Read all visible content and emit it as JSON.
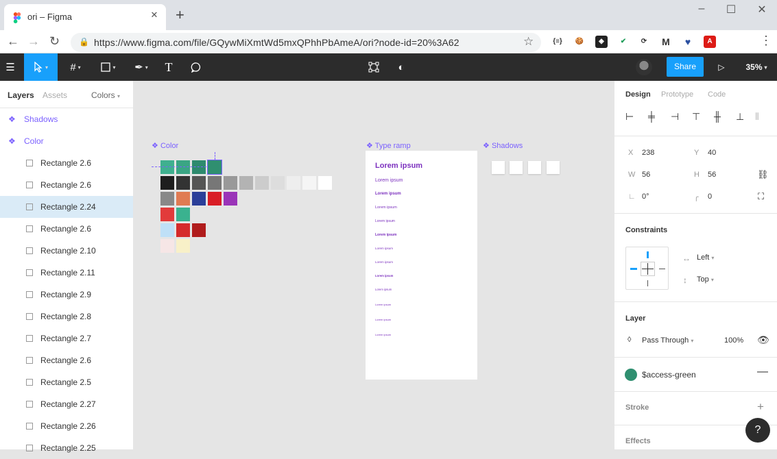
{
  "browser": {
    "tab_title": "ori – Figma",
    "tab_close": "✕",
    "new_tab": "+",
    "url": "https://www.figma.com/file/GQywMiXmtWd5mxQPhhPbAmeA/ori?node-id=20%3A62",
    "extensions": [
      "{≡}",
      "🍪",
      "◈",
      "✔",
      "⟳",
      "M",
      "♥",
      "A"
    ]
  },
  "toolbar": {
    "share_label": "Share",
    "zoom": "35%",
    "tools": [
      "move-tool",
      "frame-tool",
      "shape-tool",
      "pen-tool",
      "text-tool",
      "comment-tool"
    ]
  },
  "left_panel": {
    "tabs": [
      "Layers",
      "Assets"
    ],
    "page_selector": "Colors",
    "layers": [
      {
        "label": "Shadows",
        "type": "component"
      },
      {
        "label": "Color",
        "type": "component"
      },
      {
        "label": "Rectangle 2.6",
        "type": "rect"
      },
      {
        "label": "Rectangle 2.6",
        "type": "rect"
      },
      {
        "label": "Rectangle 2.24",
        "type": "rect",
        "selected": true
      },
      {
        "label": "Rectangle 2.6",
        "type": "rect"
      },
      {
        "label": "Rectangle 2.10",
        "type": "rect"
      },
      {
        "label": "Rectangle 2.11",
        "type": "rect"
      },
      {
        "label": "Rectangle 2.9",
        "type": "rect"
      },
      {
        "label": "Rectangle 2.8",
        "type": "rect"
      },
      {
        "label": "Rectangle 2.7",
        "type": "rect"
      },
      {
        "label": "Rectangle 2.6",
        "type": "rect"
      },
      {
        "label": "Rectangle 2.5",
        "type": "rect"
      },
      {
        "label": "Rectangle 2.27",
        "type": "rect"
      },
      {
        "label": "Rectangle 2.26",
        "type": "rect"
      },
      {
        "label": "Rectangle 2.25",
        "type": "rect"
      }
    ]
  },
  "canvas": {
    "frames": {
      "color": "Color",
      "type_ramp": "Type ramp",
      "shadows": "Shadows"
    },
    "swatch_colors": [
      [
        "#3fb08f",
        "#3aa584",
        "#2e8a6e",
        "#2f8f70"
      ],
      [
        "#1e1e1e",
        "#333333",
        "#555555",
        "#777777",
        "#999999",
        "#b3b3b3",
        "#cccccc",
        "#dddddd",
        "#eeeeee",
        "#f5f5f5",
        "#ffffff"
      ],
      [
        "#888888",
        "#e07b53",
        "#2b3f99",
        "#d91e26",
        "#9a34b8"
      ],
      [
        "#e23b3b",
        "#3ab28f"
      ],
      [
        "#bfe0f7",
        "#d52b2b",
        "#b01c1c"
      ],
      [
        "#f6e6e6",
        "#f8f0c8"
      ]
    ],
    "type_ramp_text": "Lorem ipsum"
  },
  "right_panel": {
    "tabs": [
      "Design",
      "Prototype",
      "Code"
    ],
    "props": {
      "x_label": "X",
      "x": "238",
      "y_label": "Y",
      "y": "40",
      "w_label": "W",
      "w": "56",
      "h_label": "H",
      "h": "56",
      "rotation": "0°",
      "radius": "0"
    },
    "constraints": {
      "title": "Constraints",
      "horizontal": "Left",
      "vertical": "Top"
    },
    "layer": {
      "title": "Layer",
      "blend": "Pass Through",
      "opacity": "100%"
    },
    "fill": {
      "style_name": "$access-green",
      "color": "#2f8f70"
    },
    "stroke_title": "Stroke",
    "effects_title": "Effects"
  },
  "help_label": "?"
}
